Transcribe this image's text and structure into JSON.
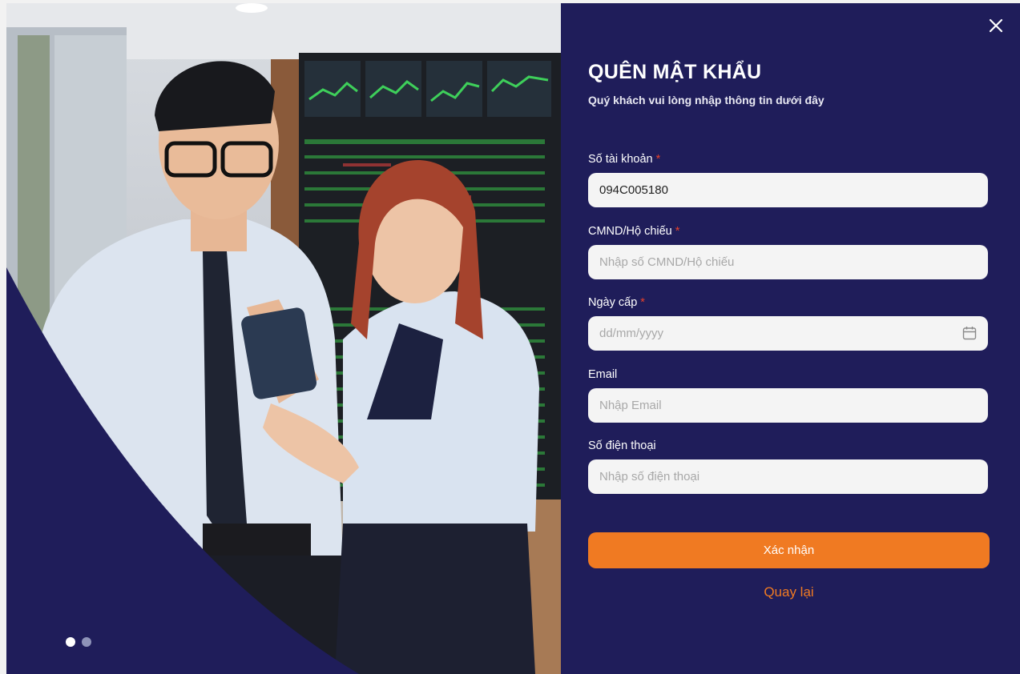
{
  "modal": {
    "title": "QUÊN MẬT KHẨU",
    "subtitle": "Quý khách vui lòng nhập thông tin dưới đây",
    "close_icon": "close-icon"
  },
  "carousel": {
    "slides": 2,
    "active_index": 0
  },
  "fields": {
    "account": {
      "label": "Số tài khoản",
      "required": "*",
      "value": "094C005180",
      "placeholder": ""
    },
    "id_card": {
      "label": "CMND/Hộ chiếu",
      "required": "*",
      "value": "",
      "placeholder": "Nhập số CMND/Hộ chiếu"
    },
    "issue_date": {
      "label": "Ngày cấp",
      "required": "*",
      "value": "",
      "placeholder": "dd/mm/yyyy",
      "icon": "calendar-icon"
    },
    "email": {
      "label": "Email",
      "value": "",
      "placeholder": "Nhập Email"
    },
    "phone": {
      "label": "Số điện thoại",
      "value": "",
      "placeholder": "Nhập số điện thoại"
    }
  },
  "actions": {
    "submit_label": "Xác nhận",
    "back_label": "Quay lại"
  },
  "colors": {
    "panel_bg": "#1f1d5a",
    "accent": "#f07a22",
    "required": "#e8412a",
    "input_bg": "#f4f4f4"
  }
}
